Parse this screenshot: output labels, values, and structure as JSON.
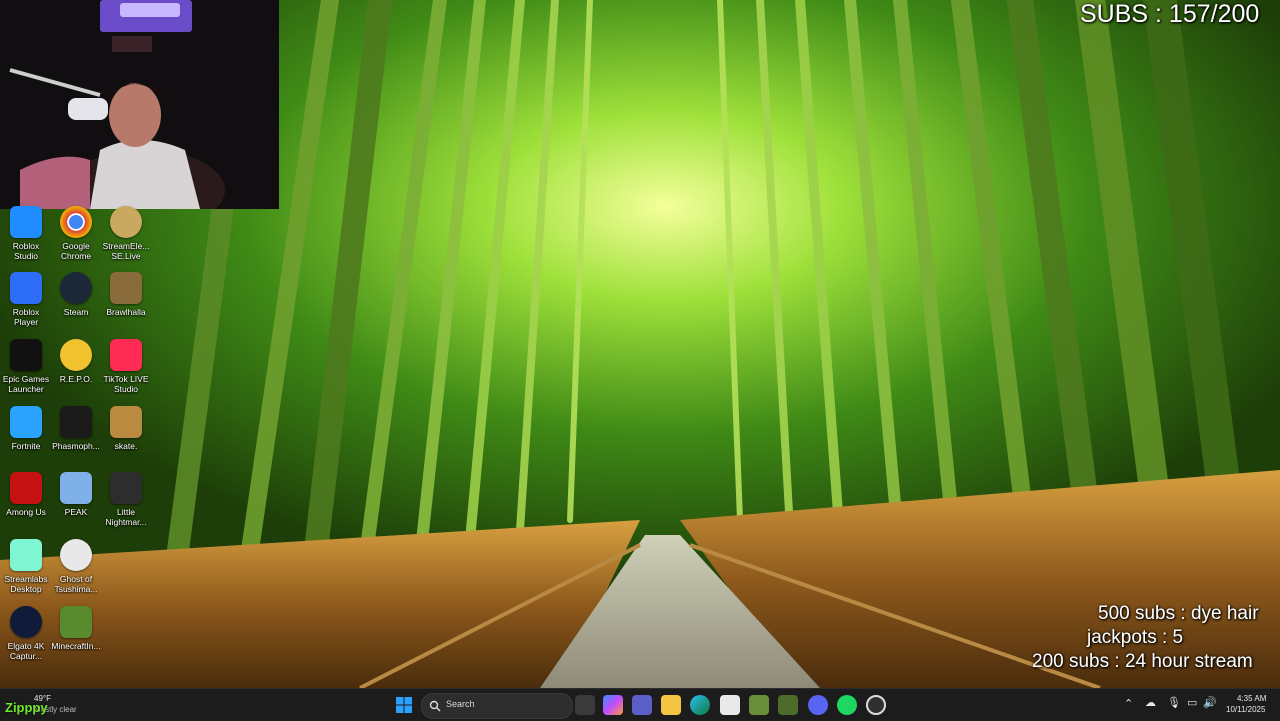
{
  "overlay": {
    "subs_counter": "SUBS : 157/200",
    "goals": [
      "500 subs : dye hair",
      "jackpots : 5",
      "200 subs : 24 hour stream"
    ],
    "watermark": "Zipppy"
  },
  "desktop_icons": [
    {
      "label": "Roblox\nStudio",
      "icon": "roblox-studio-icon",
      "color": "#1f8cff"
    },
    {
      "label": "Google\nChrome",
      "icon": "chrome-icon",
      "color": "#db4437"
    },
    {
      "label": "StreamEle...\nSE.Live",
      "icon": "streamelements-icon",
      "color": "#c9a860"
    },
    {
      "label": "Roblox Player",
      "icon": "roblox-player-icon",
      "color": "#2d6cf6"
    },
    {
      "label": "Steam",
      "icon": "steam-icon",
      "color": "#1b2838"
    },
    {
      "label": "Brawlhalla",
      "icon": "brawlhalla-icon",
      "color": "#8a6c3c"
    },
    {
      "label": "Epic Games\nLauncher",
      "icon": "epic-games-icon",
      "color": "#111111"
    },
    {
      "label": "R.E.P.O.",
      "icon": "repo-icon",
      "color": "#2b2b4f"
    },
    {
      "label": "TikTok LIVE\nStudio",
      "icon": "tiktok-icon",
      "color": "#fe2c55"
    },
    {
      "label": "Fortnite",
      "icon": "fortnite-icon",
      "color": "#2aa3ff"
    },
    {
      "label": "Phasmoph...",
      "icon": "phasmophobia-icon",
      "color": "#1a1a1a"
    },
    {
      "label": "skate.",
      "icon": "skate-icon",
      "color": "#b98a40"
    },
    {
      "label": "Among Us",
      "icon": "among-us-icon",
      "color": "#c51111"
    },
    {
      "label": "PEAK",
      "icon": "peak-icon",
      "color": "#7fb0e8"
    },
    {
      "label": "Little\nNightmar...",
      "icon": "little-nightmares-icon",
      "color": "#2d2d2d"
    },
    {
      "label": "Streamlabs\nDesktop",
      "icon": "streamlabs-icon",
      "color": "#80f5d2"
    },
    {
      "label": "Ghost of\nTsushima...",
      "icon": "ghost-of-tsushima-icon",
      "color": "#e8e8e8"
    },
    {
      "label": "Elgato 4K\nCaptur...",
      "icon": "elgato-icon",
      "color": "#101b3a"
    },
    {
      "label": "MinecraftIn...",
      "icon": "minecraft-icon",
      "color": "#5a8a2e"
    }
  ],
  "taskbar": {
    "weather_temp": "49°F",
    "weather_text": "Mostly clear",
    "search_placeholder": "Search",
    "time": "4:35 AM",
    "date": "10/11/2025",
    "apps": [
      "start-icon",
      "search-icon",
      "task-view-icon",
      "copilot-icon",
      "teams-icon",
      "file-explorer-icon",
      "edge-icon",
      "store-icon",
      "minecraft-taskbar-icon",
      "app-icon",
      "discord-icon",
      "spotify-icon",
      "obs-icon"
    ]
  }
}
